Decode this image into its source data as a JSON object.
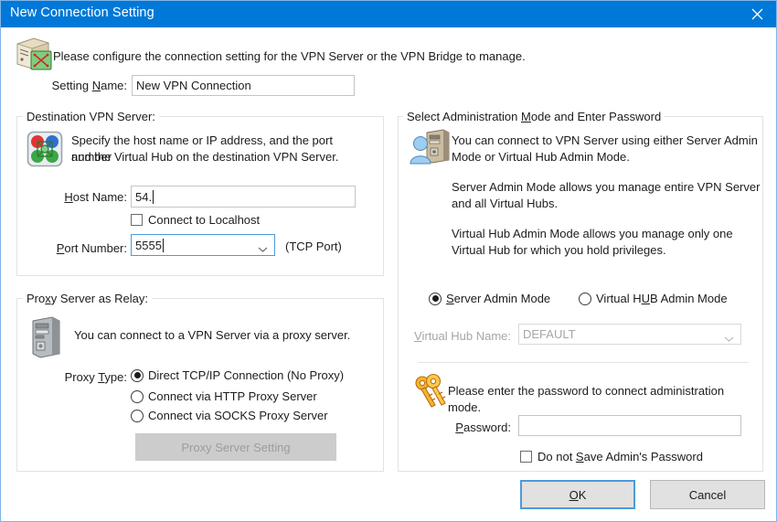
{
  "window": {
    "title": "New Connection Setting",
    "close_icon": "close-icon"
  },
  "header": {
    "icon": "package-vpn-icon",
    "description": "Please configure the connection setting for the VPN Server or the VPN Bridge to manage.",
    "setting_name_label": "Setting Name:",
    "setting_name_value": "New VPN Connection"
  },
  "destination": {
    "group_title": "Destination VPN Server:",
    "icon": "vpn-server-icon",
    "description_line1": "Specify the host name or IP address, and the port number",
    "description_line2": "and the Virtual Hub on the destination VPN Server.",
    "host_name_label": "Host Name:",
    "host_name_value": "54.",
    "connect_localhost_label": "Connect to Localhost",
    "connect_localhost_checked": false,
    "port_number_label": "Port Number:",
    "port_number_value": "5555",
    "tcp_port_note": "(TCP Port)"
  },
  "proxy": {
    "group_title": "Proxy Server as Relay:",
    "icon": "computer-tower-icon",
    "description": "You can connect to a VPN Server via a proxy server.",
    "proxy_type_label": "Proxy Type:",
    "options": [
      {
        "label": "Direct TCP/IP Connection (No Proxy)",
        "selected": true
      },
      {
        "label": "Connect via HTTP Proxy Server",
        "selected": false
      },
      {
        "label": "Connect via SOCKS Proxy Server",
        "selected": false
      }
    ],
    "proxy_setting_button": "Proxy Server Setting",
    "proxy_setting_enabled": false
  },
  "admin": {
    "group_title": "Select Administration Mode and Enter Password",
    "icon": "user-server-icon",
    "paragraph1_line1": "You can connect to VPN Server using either Server Admin",
    "paragraph1_line2": "Mode or Virtual Hub Admin Mode.",
    "paragraph2_line1": "Server Admin Mode allows you manage entire VPN Server",
    "paragraph2_line2": "and all Virtual Hubs.",
    "paragraph3_line1": "Virtual Hub Admin Mode allows you manage only one",
    "paragraph3_line2": "Virtual Hub for which you hold privileges.",
    "mode_server_label": "Server Admin Mode",
    "mode_server_selected": true,
    "mode_hub_label": "Virtual HUB Admin Mode",
    "mode_hub_selected": false,
    "virtual_hub_name_label": "Virtual Hub Name:",
    "virtual_hub_name_value": "DEFAULT",
    "virtual_hub_name_enabled": false,
    "key_icon": "keys-icon",
    "password_prompt": "Please enter the password to connect administration mode.",
    "password_label": "Password:",
    "password_value": "",
    "do_not_save_label": "Do not Save Admin's Password",
    "do_not_save_checked": false
  },
  "footer": {
    "ok_label": "OK",
    "cancel_label": "Cancel"
  },
  "colors": {
    "titlebar": "#0078d7",
    "accent": "#4a9bdc",
    "border": "#e2e2e2",
    "text": "#1c1c1c",
    "disabled_text": "#a6a6a6"
  }
}
